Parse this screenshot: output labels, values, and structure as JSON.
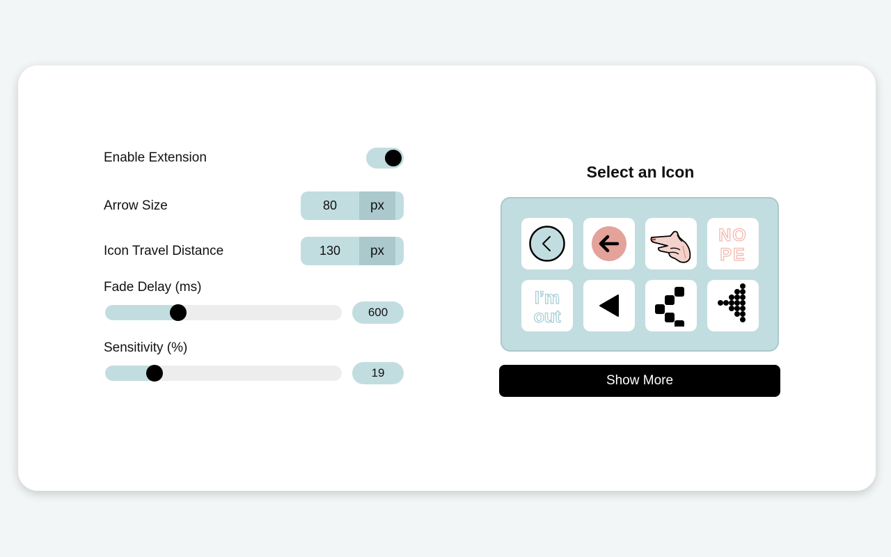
{
  "settings": {
    "enable_extension": {
      "label": "Enable Extension",
      "enabled": true
    },
    "arrow_size": {
      "label": "Arrow Size",
      "value": "80",
      "unit": "px"
    },
    "icon_travel_distance": {
      "label": "Icon Travel Distance",
      "value": "130",
      "unit": "px"
    },
    "fade_delay": {
      "label": "Fade Delay (ms)",
      "value": "600",
      "fraction": 0.31
    },
    "sensitivity": {
      "label": "Sensitivity (%)",
      "value": "19",
      "fraction": 0.21
    }
  },
  "icon_panel": {
    "title": "Select an Icon",
    "icons": [
      "circle-chevron-left-icon",
      "pink-circle-arrow-left-icon",
      "pointing-hand-icon",
      "nope-text-icon",
      "im-out-text-icon",
      "triangle-left-icon",
      "blocky-arrow-left-icon",
      "dotted-arrow-left-icon"
    ],
    "show_more_label": "Show More"
  },
  "colors": {
    "accent": "#c2dde0",
    "accent_dark": "#abc9cc",
    "track": "#ededed",
    "pink": "#e3a39a",
    "button": "#000000"
  }
}
